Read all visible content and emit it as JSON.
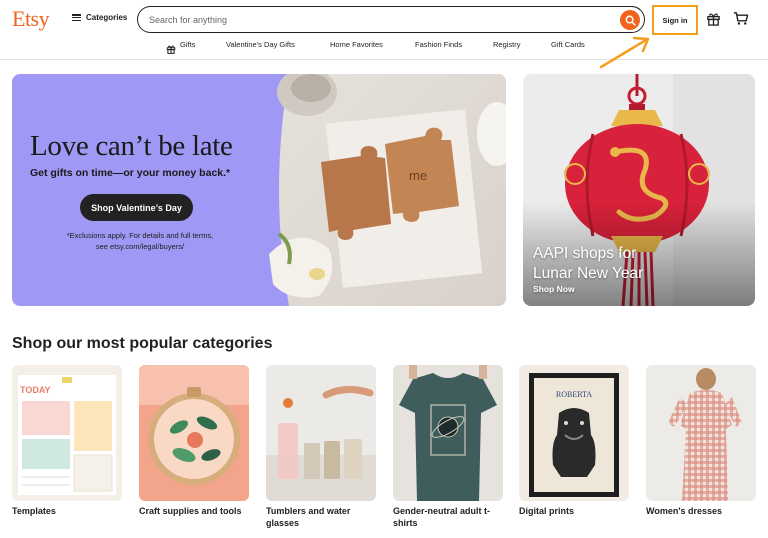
{
  "header": {
    "logo": "Etsy",
    "categories_label": "Categories",
    "search_placeholder": "Search for anything",
    "signin_label": "Sign in"
  },
  "nav": {
    "items": [
      "Gifts",
      "Valentine's Day Gifts",
      "Home Favorites",
      "Fashion Finds",
      "Registry",
      "Gift Cards"
    ]
  },
  "hero": {
    "title": "Love can’t be late",
    "subtitle": "Get gifts on time—or your money back.*",
    "button": "Shop Valentine’s Day",
    "note": "*Exclusions apply. For details and full terms, see etsy.com/legal/buyers/",
    "puzzle_text": "me"
  },
  "lunar": {
    "title_line1": "AAPI shops for",
    "title_line2": "Lunar New Year",
    "cta": "Shop Now"
  },
  "section_title": "Shop our most popular categories",
  "categories": [
    {
      "label": "Templates",
      "img_text": "TODAY"
    },
    {
      "label": "Craft supplies and tools"
    },
    {
      "label": "Tumblers and water glasses"
    },
    {
      "label": "Gender-neutral adult t-shirts"
    },
    {
      "label": "Digital prints",
      "img_text": "ROBERTA"
    },
    {
      "label": "Women's dresses"
    }
  ],
  "colors": {
    "brand": "#F1641E",
    "hero_bg": "#9F98F4",
    "highlight": "#F59E1E",
    "lantern_red": "#D8213A",
    "lantern_gold": "#E8B84A"
  },
  "icons": [
    "hamburger-icon",
    "search-icon",
    "gift-icon",
    "cart-icon"
  ]
}
